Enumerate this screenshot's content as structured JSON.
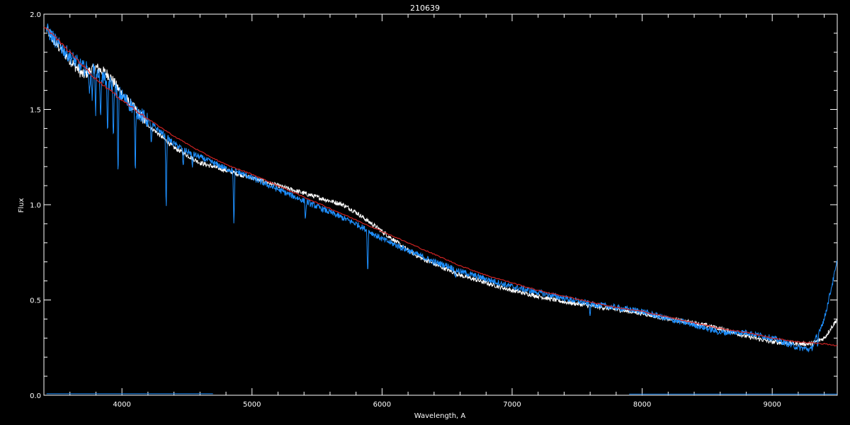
{
  "chart_data": {
    "type": "line",
    "title": "210639",
    "xlabel": "Wavelength, A",
    "ylabel": "Flux",
    "xlim": [
      3400,
      9500
    ],
    "ylim": [
      0.0,
      2.0
    ],
    "x_ticks": [
      4000,
      5000,
      6000,
      7000,
      8000,
      9000
    ],
    "x_tick_labels": [
      "4000",
      "5000",
      "6000",
      "7000",
      "8000",
      "9000"
    ],
    "y_ticks": [
      0.0,
      0.5,
      1.0,
      1.5,
      2.0
    ],
    "y_tick_labels": [
      "0.0",
      "0.5",
      "1.0",
      "1.5",
      "2.0"
    ],
    "grid": false,
    "colors": {
      "background": "#000000",
      "axes": "#ffffff",
      "white_series": "#ffffff",
      "blue_series": "#1e90ff",
      "red_series": "#cc2222"
    },
    "series": [
      {
        "color": "#ffffff",
        "x": [
          3420,
          3500,
          3600,
          3700,
          3800,
          3900,
          4000,
          4100,
          4200,
          4300,
          4400,
          4500,
          4600,
          4700,
          4800,
          4900,
          5000,
          5100,
          5200,
          5300,
          5400,
          5500,
          5600,
          5700,
          5800,
          5900,
          6000,
          6100,
          6200,
          6300,
          6400,
          6500,
          6600,
          6700,
          6800,
          6900,
          7000,
          7200,
          7400,
          7600,
          7800,
          8000,
          8200,
          8400,
          8600,
          8800,
          9000,
          9200,
          9300,
          9400,
          9500
        ],
        "y": [
          1.92,
          1.84,
          1.76,
          1.68,
          1.72,
          1.68,
          1.58,
          1.5,
          1.42,
          1.36,
          1.3,
          1.26,
          1.22,
          1.2,
          1.18,
          1.16,
          1.14,
          1.12,
          1.1,
          1.08,
          1.06,
          1.04,
          1.02,
          1.0,
          0.96,
          0.91,
          0.86,
          0.81,
          0.76,
          0.72,
          0.69,
          0.66,
          0.63,
          0.61,
          0.59,
          0.57,
          0.55,
          0.52,
          0.49,
          0.47,
          0.45,
          0.43,
          0.4,
          0.38,
          0.35,
          0.31,
          0.28,
          0.27,
          0.27,
          0.3,
          0.4
        ]
      },
      {
        "color": "#1e90ff",
        "x": [
          3420,
          3500,
          3600,
          3700,
          3800,
          3900,
          4000,
          4100,
          4200,
          4300,
          4400,
          4500,
          4600,
          4700,
          4800,
          4900,
          5000,
          5100,
          5200,
          5300,
          5400,
          5500,
          5600,
          5700,
          5800,
          5900,
          6000,
          6100,
          6200,
          6300,
          6400,
          6500,
          6600,
          6700,
          6800,
          6900,
          7000,
          7200,
          7400,
          7600,
          7800,
          8000,
          8200,
          8400,
          8600,
          8800,
          9000,
          9200,
          9300,
          9400,
          9500
        ],
        "y": [
          1.92,
          1.85,
          1.78,
          1.72,
          1.7,
          1.64,
          1.57,
          1.5,
          1.44,
          1.38,
          1.32,
          1.28,
          1.25,
          1.22,
          1.19,
          1.17,
          1.14,
          1.11,
          1.08,
          1.05,
          1.02,
          0.99,
          0.96,
          0.93,
          0.9,
          0.86,
          0.82,
          0.79,
          0.76,
          0.73,
          0.7,
          0.68,
          0.65,
          0.63,
          0.61,
          0.59,
          0.57,
          0.54,
          0.51,
          0.48,
          0.46,
          0.44,
          0.4,
          0.37,
          0.33,
          0.33,
          0.3,
          0.25,
          0.24,
          0.4,
          0.7
        ]
      },
      {
        "color": "#cc2222",
        "x": [
          3400,
          3600,
          3800,
          4000,
          4200,
          4400,
          4600,
          4800,
          5000,
          5200,
          5400,
          5600,
          5800,
          6000,
          6200,
          6400,
          6600,
          6800,
          7000,
          7200,
          7400,
          7600,
          7800,
          8000,
          8200,
          8400,
          8600,
          8800,
          9000,
          9200,
          9400,
          9500
        ],
        "y": [
          1.94,
          1.8,
          1.66,
          1.55,
          1.45,
          1.36,
          1.28,
          1.21,
          1.16,
          1.1,
          1.04,
          0.98,
          0.92,
          0.86,
          0.8,
          0.74,
          0.68,
          0.63,
          0.59,
          0.55,
          0.52,
          0.49,
          0.46,
          0.44,
          0.41,
          0.38,
          0.35,
          0.33,
          0.3,
          0.28,
          0.27,
          0.26
        ]
      }
    ],
    "absorption_lines": [
      {
        "x": 3750,
        "depth": 0.16
      },
      {
        "x": 3770,
        "depth": 0.18
      },
      {
        "x": 3798,
        "depth": 0.2
      },
      {
        "x": 3835,
        "depth": 0.26
      },
      {
        "x": 3889,
        "depth": 0.32
      },
      {
        "x": 3934,
        "depth": 0.3
      },
      {
        "x": 3970,
        "depth": 0.5
      },
      {
        "x": 4102,
        "depth": 0.36
      },
      {
        "x": 4226,
        "depth": 0.12
      },
      {
        "x": 4340,
        "depth": 0.4
      },
      {
        "x": 4471,
        "depth": 0.1
      },
      {
        "x": 4541,
        "depth": 0.08
      },
      {
        "x": 4861,
        "depth": 0.32
      },
      {
        "x": 5411,
        "depth": 0.1
      },
      {
        "x": 5890,
        "depth": 0.24
      },
      {
        "x": 6563,
        "depth": 0.06
      },
      {
        "x": 7600,
        "depth": 0.06
      },
      {
        "x": 9350,
        "depth": 0.08
      }
    ]
  }
}
